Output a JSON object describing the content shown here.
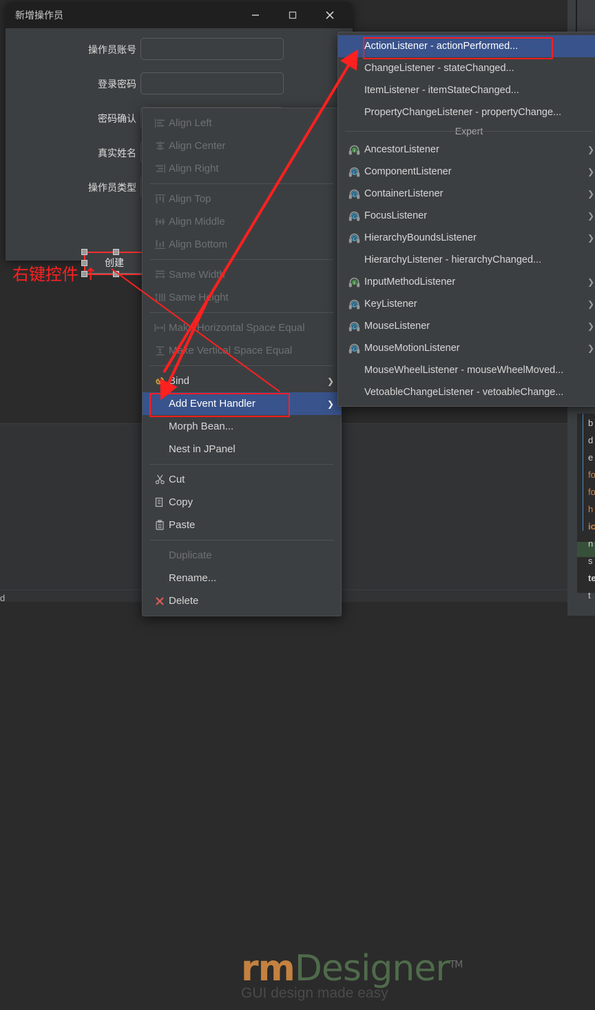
{
  "dialog": {
    "title": "新增操作员",
    "window_controls": [
      {
        "name": "minimize",
        "glyph": "—"
      },
      {
        "name": "maximize",
        "glyph": "▢"
      },
      {
        "name": "close",
        "glyph": "✕"
      }
    ],
    "fields": [
      {
        "label": "操作员账号",
        "value": "",
        "placeholder": ""
      },
      {
        "label": "登录密码",
        "value": "",
        "placeholder": ""
      },
      {
        "label": "密码确认",
        "value": "",
        "placeholder": ""
      },
      {
        "label": "真实姓名",
        "value": "",
        "placeholder": ""
      },
      {
        "label": "操作员类型",
        "value": "",
        "placeholder": ""
      }
    ],
    "create_button": "创建"
  },
  "annotations": {
    "right_click_hint": "右键控件 ↑",
    "arrow_color": "#ff2020",
    "highlight_box_color": "#ff1e1e"
  },
  "context_menu": {
    "items": [
      {
        "label": "Align Left",
        "icon": "align-left-icon",
        "disabled": true,
        "submenu": false
      },
      {
        "label": "Align Center",
        "icon": "align-center-icon",
        "disabled": true,
        "submenu": false
      },
      {
        "label": "Align Right",
        "icon": "align-right-icon",
        "disabled": true,
        "submenu": false
      },
      {
        "separator": true
      },
      {
        "label": "Align Top",
        "icon": "align-top-icon",
        "disabled": true,
        "submenu": false
      },
      {
        "label": "Align Middle",
        "icon": "align-middle-icon",
        "disabled": true,
        "submenu": false
      },
      {
        "label": "Align Bottom",
        "icon": "align-bottom-icon",
        "disabled": true,
        "submenu": false
      },
      {
        "separator": true
      },
      {
        "label": "Same Width",
        "icon": "same-width-icon",
        "disabled": true,
        "submenu": false
      },
      {
        "label": "Same Height",
        "icon": "same-height-icon",
        "disabled": true,
        "submenu": false
      },
      {
        "separator": true
      },
      {
        "label": "Make Horizontal Space Equal",
        "icon": "h-space-icon",
        "disabled": true,
        "submenu": false
      },
      {
        "label": "Make Vertical Space Equal",
        "icon": "v-space-icon",
        "disabled": true,
        "submenu": false
      },
      {
        "separator": true
      },
      {
        "label": "Bind",
        "icon": "bind-icon",
        "disabled": false,
        "submenu": true
      },
      {
        "label": "Add Event Handler",
        "icon": "",
        "disabled": false,
        "submenu": true,
        "selected": true,
        "highlighted": true
      },
      {
        "label": "Morph Bean...",
        "icon": "",
        "disabled": false,
        "submenu": false
      },
      {
        "label": "Nest in JPanel",
        "icon": "",
        "disabled": false,
        "submenu": false
      },
      {
        "separator": true
      },
      {
        "label": "Cut",
        "icon": "cut-icon",
        "disabled": false,
        "submenu": false
      },
      {
        "label": "Copy",
        "icon": "copy-icon",
        "disabled": false,
        "submenu": false
      },
      {
        "label": "Paste",
        "icon": "paste-icon",
        "disabled": false,
        "submenu": false
      },
      {
        "separator": true
      },
      {
        "label": "Duplicate",
        "icon": "",
        "disabled": true,
        "submenu": false
      },
      {
        "label": "Rename...",
        "icon": "",
        "disabled": false,
        "submenu": false
      },
      {
        "label": "Delete",
        "icon": "delete-icon",
        "disabled": false,
        "submenu": false
      }
    ]
  },
  "event_submenu": {
    "items": [
      {
        "label": "ActionListener - actionPerformed...",
        "icon": "",
        "selected": true,
        "highlighted": true,
        "submenu": false
      },
      {
        "label": "ChangeListener - stateChanged...",
        "icon": "",
        "submenu": false
      },
      {
        "label": "ItemListener - itemStateChanged...",
        "icon": "",
        "submenu": false
      },
      {
        "label": "PropertyChangeListener - propertyChange...",
        "icon": "",
        "submenu": false
      },
      {
        "group": "Expert"
      },
      {
        "label": "AncestorListener",
        "icon": "listener-green-icon",
        "submenu": true
      },
      {
        "label": "ComponentListener",
        "icon": "listener-blue-icon",
        "submenu": true
      },
      {
        "label": "ContainerListener",
        "icon": "listener-blue-icon",
        "submenu": true
      },
      {
        "label": "FocusListener",
        "icon": "listener-blue-icon",
        "submenu": true
      },
      {
        "label": "HierarchyBoundsListener",
        "icon": "listener-blue-icon",
        "submenu": true
      },
      {
        "label": "HierarchyListener - hierarchyChanged...",
        "icon": "",
        "submenu": false
      },
      {
        "label": "InputMethodListener",
        "icon": "listener-green-icon",
        "submenu": true
      },
      {
        "label": "KeyListener",
        "icon": "listener-blue-icon",
        "submenu": true
      },
      {
        "label": "MouseListener",
        "icon": "listener-blue-icon",
        "submenu": true
      },
      {
        "label": "MouseMotionListener",
        "icon": "listener-blue-icon",
        "submenu": true
      },
      {
        "label": "MouseWheelListener - mouseWheelMoved...",
        "icon": "",
        "submenu": false
      },
      {
        "label": "VetoableChangeListener - vetoableChange...",
        "icon": "",
        "submenu": false
      }
    ]
  },
  "watermark": {
    "brand_orange": "rm",
    "brand_green": "Designer",
    "trademark": "TM",
    "tagline": "GUI design made easy"
  },
  "ide": {
    "bottom_left_fragment": "d",
    "property_fragments": [
      "b",
      "d",
      "e",
      "fo",
      "fo",
      "h",
      "ic",
      "n",
      "s",
      "te",
      "t"
    ]
  },
  "colors": {
    "window_bg": "#3c3f41",
    "titlebar_bg": "#1f1f1f",
    "menu_bg": "#3c3f41",
    "menu_selected": "#39538c",
    "canvas_bg": "#313335",
    "accent_red": "#ff1e1e",
    "divider_blue": "#4a88c7"
  }
}
